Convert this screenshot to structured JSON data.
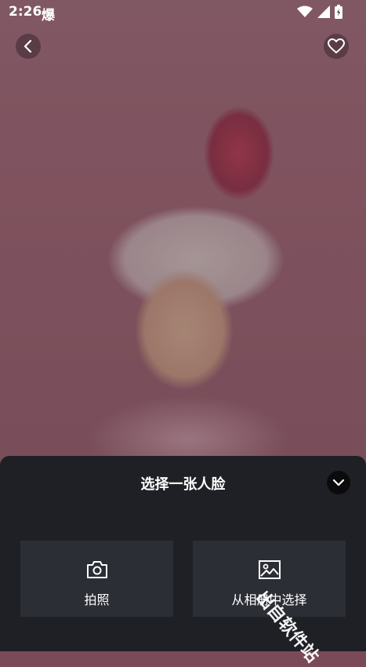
{
  "status_bar": {
    "time": "2:26",
    "app_glyph": "爆"
  },
  "photo": {
    "description_icon": "portrait-photo"
  },
  "nav": {
    "back_icon": "chevron-left-icon",
    "favorite_icon": "heart-icon"
  },
  "sheet": {
    "title": "选择一张人脸",
    "collapse_icon": "chevron-down-icon",
    "options": [
      {
        "label": "拍照",
        "icon": "camera-icon"
      },
      {
        "label": "从相册中选择",
        "icon": "image-icon"
      }
    ]
  },
  "watermark": "出自软件站"
}
